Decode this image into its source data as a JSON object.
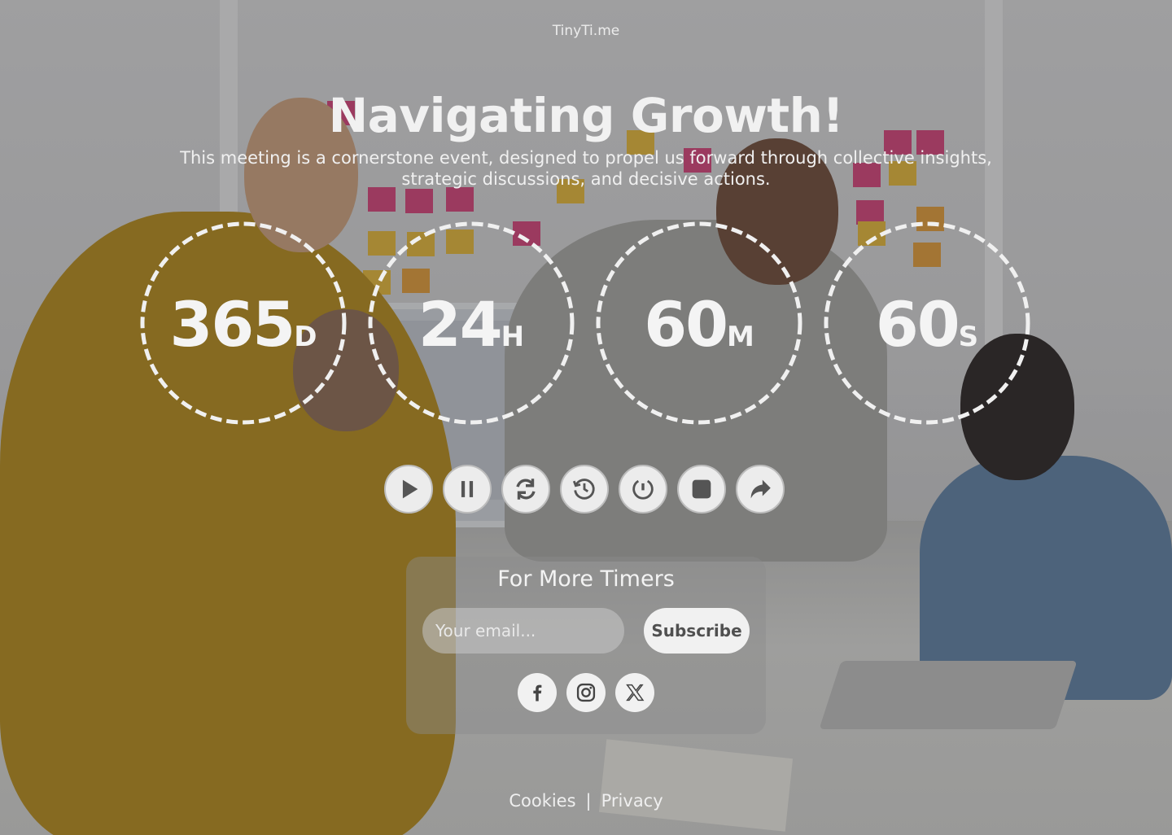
{
  "brand": "TinyTi.me",
  "title": "Navigating Growth!",
  "subtitle": "This meeting is a cornerstone event, designed to propel us forward through collective insights, strategic discussions, and decisive actions.",
  "timers": [
    {
      "value": "365",
      "unit": "D"
    },
    {
      "value": "24",
      "unit": "H"
    },
    {
      "value": "60",
      "unit": "M"
    },
    {
      "value": "60",
      "unit": "S"
    }
  ],
  "controls": [
    "play-icon",
    "pause-icon",
    "refresh-icon",
    "history-icon",
    "timer-reset-icon",
    "stop-icon",
    "share-icon"
  ],
  "subscribe": {
    "heading": "For More Timers",
    "email_placeholder": "Your email...",
    "button_label": "Subscribe"
  },
  "social": [
    "facebook-icon",
    "instagram-icon",
    "x-icon"
  ],
  "footer": {
    "cookies": "Cookies",
    "separator": "|",
    "privacy": "Privacy"
  }
}
